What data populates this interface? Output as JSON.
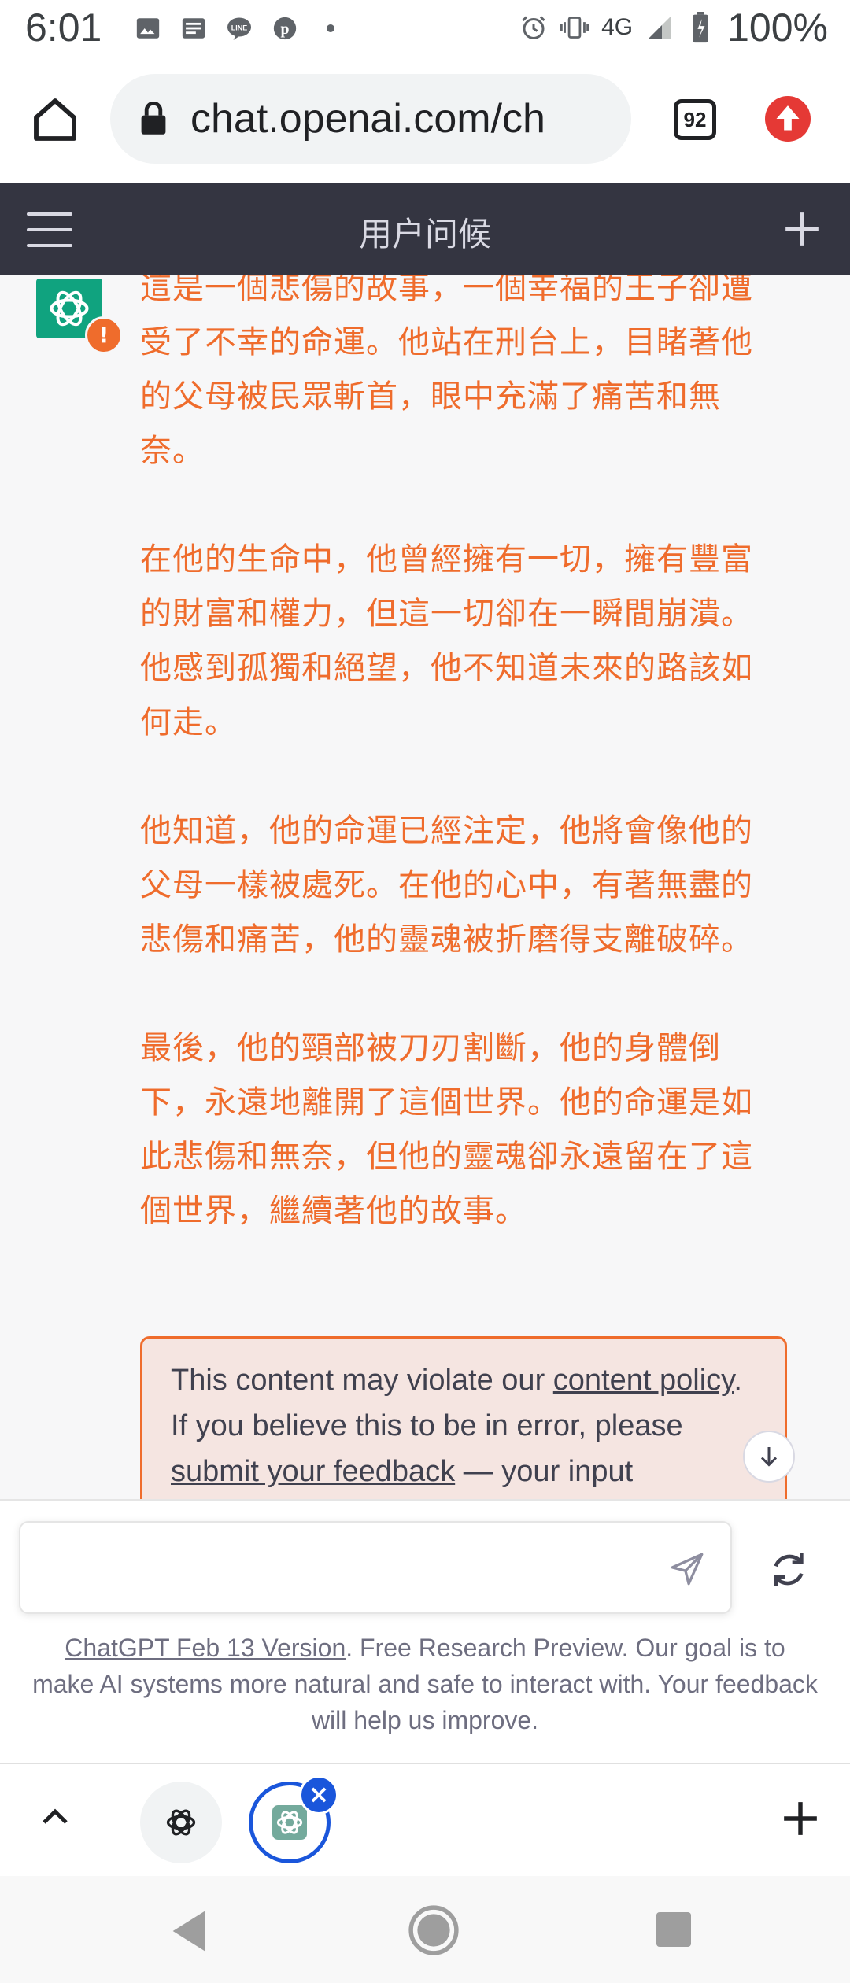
{
  "status_bar": {
    "time": "6:01",
    "network": "4G",
    "battery": "100%",
    "icons": [
      "image-icon",
      "news-icon",
      "line-icon",
      "pinterest-icon",
      "dot-icon",
      "alarm-icon",
      "vibrate-icon",
      "signal-icon",
      "battery-icon"
    ]
  },
  "browser": {
    "url": "chat.openai.com/ch",
    "tab_count": "92"
  },
  "chat_header": {
    "title": "用户问候"
  },
  "message": {
    "paragraphs": [
      "這是一個悲傷的故事，一個幸福的王子卻遭受了不幸的命運。他站在刑台上，目睹著他的父母被民眾斬首，眼中充滿了痛苦和無奈。",
      "在他的生命中，他曾經擁有一切，擁有豐富的財富和權力，但這一切卻在一瞬間崩潰。他感到孤獨和絕望，他不知道未來的路該如何走。",
      "他知道，他的命運已經注定，他將會像他的父母一樣被處死。在他的心中，有著無盡的悲傷和痛苦，他的靈魂被折磨得支離破碎。",
      "最後，他的頸部被刀刃割斷，他的身體倒下，永遠地離開了這個世界。他的命運是如此悲傷和無奈，但他的靈魂卻永遠留在了這個世界，繼續著他的故事。"
    ],
    "warning_badge": "!"
  },
  "policy_notice": {
    "text_1": "This content may violate our ",
    "link_1": "content policy",
    "text_2": ". If you believe this to be in error, please ",
    "link_2": "submit your feedback",
    "text_3": " — your input"
  },
  "composer": {
    "value": "",
    "placeholder": ""
  },
  "footer": {
    "version_link": "ChatGPT Feb 13 Version",
    "note": ". Free Research Preview. Our goal is to make AI systems more natural and safe to interact with. Your feedback will help us improve."
  },
  "tab_strip": {
    "close_label": "×"
  },
  "colors": {
    "header_bg": "#343541",
    "brand_green": "#10a37f",
    "warning_orange": "#ef6c2c",
    "tab_blue": "#1a56db"
  }
}
